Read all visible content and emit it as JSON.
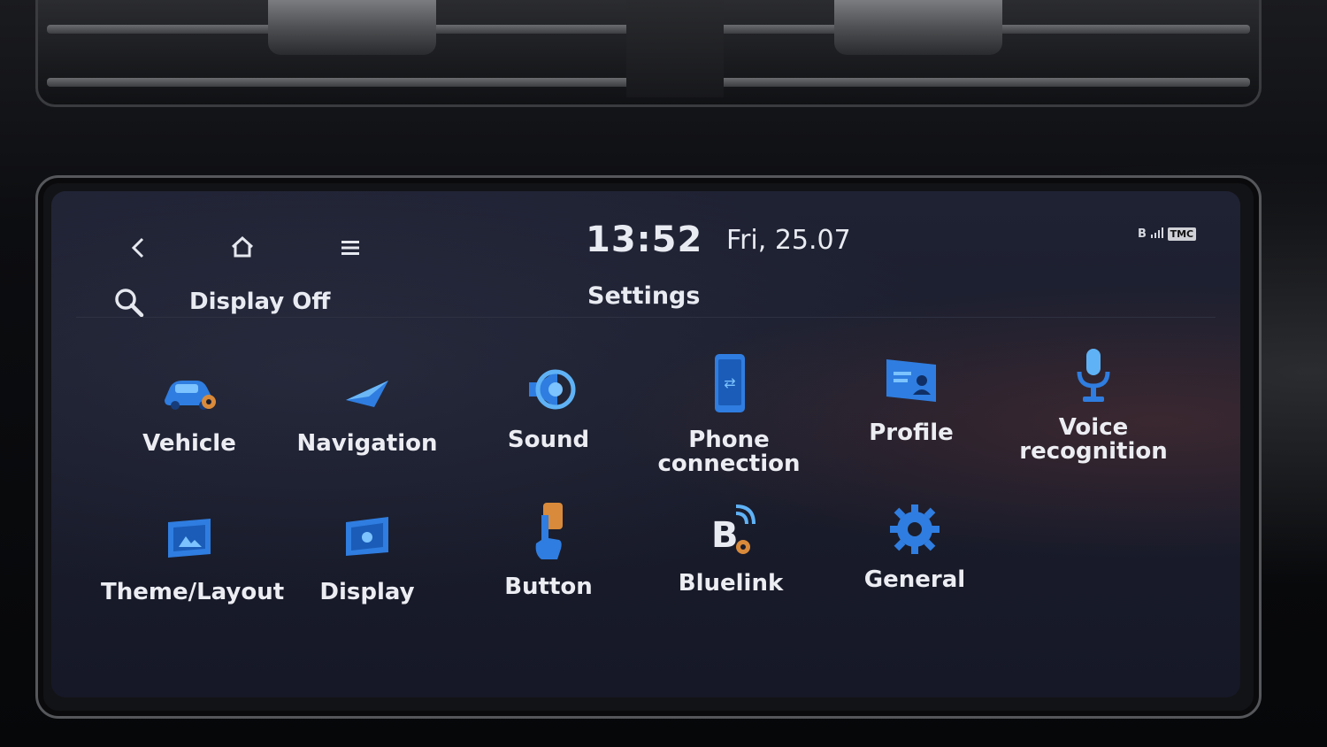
{
  "header": {
    "back_icon": "back-arrow-icon",
    "home_icon": "home-icon",
    "menu_icon": "menu-icon",
    "time": "13:52",
    "date": "Fri, 25.07",
    "status": {
      "bluetooth": "B",
      "tmc": "TMC"
    }
  },
  "toolbar": {
    "search_icon": "search-icon",
    "display_off": "Display Off",
    "title": "Settings"
  },
  "items": [
    {
      "label": "Vehicle",
      "icon": "vehicle-icon"
    },
    {
      "label": "Navigation",
      "icon": "navigation-icon"
    },
    {
      "label": "Sound",
      "icon": "sound-icon"
    },
    {
      "label": "Phone connection",
      "icon": "phone-connection-icon"
    },
    {
      "label": "Profile",
      "icon": "profile-icon"
    },
    {
      "label": "Voice recognition",
      "icon": "voice-recognition-icon"
    },
    {
      "label": "Theme/Layout",
      "icon": "theme-layout-icon"
    },
    {
      "label": "Display",
      "icon": "display-icon"
    },
    {
      "label": "Button",
      "icon": "button-icon"
    },
    {
      "label": "Bluelink",
      "icon": "bluelink-icon"
    },
    {
      "label": "General",
      "icon": "general-icon"
    }
  ],
  "colors": {
    "accent": "#2f7de0",
    "accent_light": "#5fb2f5",
    "orange": "#d98a3a",
    "screen_bg": "#1b1e2d"
  }
}
